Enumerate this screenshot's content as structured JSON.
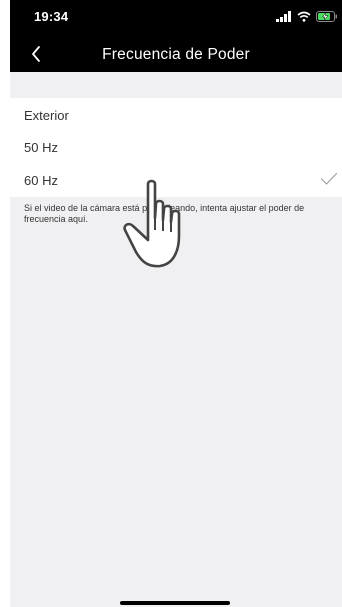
{
  "status_bar": {
    "time": "19:34",
    "icons": [
      "signal-icon",
      "wifi-icon",
      "battery-charging-icon"
    ],
    "battery_color": "#4cd964"
  },
  "nav": {
    "title": "Frecuencia de Poder",
    "back_icon": "chevron-left-icon"
  },
  "options": {
    "header": "Exterior",
    "items": [
      {
        "label": "50 Hz",
        "selected": false
      },
      {
        "label": "60 Hz",
        "selected": true
      }
    ]
  },
  "hint": {
    "text": "Si el video de la cámara está parpadeando, intenta ajustar el poder de frecuencia aquí."
  },
  "colors": {
    "nav_background": "#000000",
    "page_background": "#f0f0f2",
    "row_background": "#ffffff",
    "text": "#333333"
  }
}
